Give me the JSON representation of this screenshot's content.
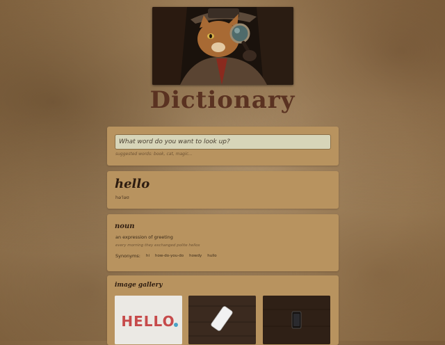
{
  "app": {
    "title": "Dictionary"
  },
  "search": {
    "placeholder": "What word do you want to look up?",
    "hint": "suggested words: book, cat, magic..."
  },
  "result": {
    "word": "hello",
    "phonetic": "həˈləʊ"
  },
  "meaning": {
    "part_of_speech": "noun",
    "definition": "an expression of greeting",
    "example": "every morning they exchanged polite hellos",
    "synonyms_label": "Synonyms:",
    "synonyms": [
      "hi",
      "how-do-you-do",
      "howdy",
      "hullo"
    ]
  },
  "gallery": {
    "title": "image gallery",
    "thumbnail_1_text": "HELLO"
  },
  "colors": {
    "card": "#b8935f",
    "title": "#5a3221",
    "input_bg": "#d7d5b9"
  }
}
